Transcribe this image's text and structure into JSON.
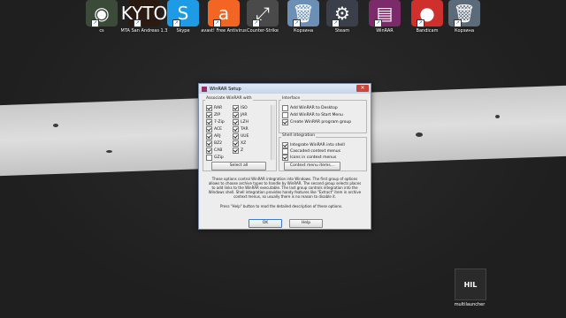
{
  "desktop": {
    "icons": [
      {
        "label": "cs",
        "symbol": "◉",
        "color": "#3c4a3a"
      },
      {
        "label": "MTA San Andreas 1.3",
        "symbol": "KYTO",
        "color": "#2a1a12"
      },
      {
        "label": "Skype",
        "symbol": "S",
        "color": "#1d9be6"
      },
      {
        "label": "avast! Free Antivirus",
        "symbol": "a",
        "color": "#f26522"
      },
      {
        "label": "Counter-Strike",
        "symbol": "⤢",
        "color": "#4a4a4a"
      },
      {
        "label": "Корзина",
        "symbol": "🗑",
        "color": "#6b8fb5"
      },
      {
        "label": "Steam",
        "symbol": "⚙",
        "color": "#3a3f4a"
      },
      {
        "label": "WinRAR",
        "symbol": "▤",
        "color": "#7b2b6a"
      },
      {
        "label": "Bandicam",
        "symbol": "●",
        "color": "#d0302b"
      },
      {
        "label": "Корзина",
        "symbol": "🗑",
        "color": "#5c6b7a"
      }
    ],
    "hil_label": "HIL",
    "hil_caption": "multilauncher"
  },
  "dialog": {
    "title": "WinRAR Setup",
    "close_glyph": "✕",
    "associate_label": "Associate WinRAR with",
    "formats_col1": [
      {
        "label": "RAR",
        "checked": true
      },
      {
        "label": "ZIP",
        "checked": true
      },
      {
        "label": "7-Zip",
        "checked": true
      },
      {
        "label": "ACE",
        "checked": true
      },
      {
        "label": "ARJ",
        "checked": true
      },
      {
        "label": "BZ2",
        "checked": true
      },
      {
        "label": "CAB",
        "checked": true
      },
      {
        "label": "GZip",
        "checked": false
      }
    ],
    "formats_col2": [
      {
        "label": "ISO",
        "checked": true
      },
      {
        "label": "JAR",
        "checked": true
      },
      {
        "label": "LZH",
        "checked": true
      },
      {
        "label": "TAR",
        "checked": true
      },
      {
        "label": "UUE",
        "checked": true
      },
      {
        "label": "XZ",
        "checked": true
      },
      {
        "label": "Z",
        "checked": true
      }
    ],
    "select_all_label": "Select all",
    "interface_label": "Interface",
    "interface_opts": [
      {
        "label": "Add WinRAR to Desktop",
        "checked": false
      },
      {
        "label": "Add WinRAR to Start Menu",
        "checked": false
      },
      {
        "label": "Create WinRAR program group",
        "checked": true
      }
    ],
    "shell_label": "Shell integration",
    "shell_opts": [
      {
        "label": "Integrate WinRAR into shell",
        "checked": true
      },
      {
        "label": "Cascaded context menus",
        "checked": false
      },
      {
        "label": "Icons in context menus",
        "checked": true
      }
    ],
    "context_menu_btn": "Context menu items...",
    "description": "These options control WinRAR integration into Windows. The first group of options allows to choose archive types to handle by WinRAR. The second group selects places to add links to the WinRAR executable. The last group controls integration into the Windows shell. Shell integration provides handy features like \"Extract\" item in archive context menus, so usually there is no reason to disable it.",
    "description2": "Press \"Help\" button to read the detailed description of these options.",
    "ok_label": "OK",
    "help_label": "Help"
  }
}
